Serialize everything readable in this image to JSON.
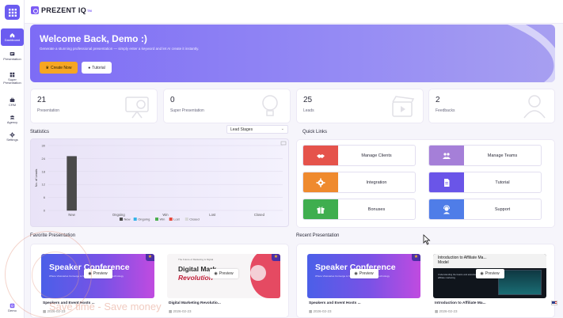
{
  "app": {
    "brand": "PREZENT IQ",
    "brand_tm": "TM"
  },
  "sidebar": {
    "items": [
      {
        "label": "Dashboard",
        "icon": "home-icon",
        "active": true
      },
      {
        "label": "Presentation",
        "icon": "slides-icon"
      },
      {
        "label": "Super Presentation",
        "icon": "grid-icon"
      },
      {
        "label": "CRM",
        "icon": "briefcase-icon"
      },
      {
        "label": "Agency",
        "icon": "people-icon"
      },
      {
        "label": "Settings",
        "icon": "gear-icon"
      }
    ],
    "user_label": "Demo"
  },
  "hero": {
    "title": "Welcome Back, Demo :)",
    "subtitle": "Generate a stunning professional presentation — simply enter a keyword and let AI create it instantly.",
    "create_label": "Create Now",
    "tutorial_label": "Tutorial"
  },
  "stats": [
    {
      "value": "21",
      "label": "Presentation"
    },
    {
      "value": "0",
      "label": "Super Presentation"
    },
    {
      "value": "25",
      "label": "Leads"
    },
    {
      "value": "2",
      "label": "Feedbacks"
    }
  ],
  "statistics": {
    "title": "Statistics",
    "select_value": "Lead Stages"
  },
  "chart_data": {
    "type": "bar",
    "categories": [
      "New",
      "Ongoing",
      "Win",
      "Lost",
      "Closed"
    ],
    "values": [
      25,
      0,
      0,
      0,
      0
    ],
    "ylabel": "No. of Leads",
    "yticks": [
      0,
      6,
      12,
      18,
      24,
      30
    ],
    "ylim": [
      0,
      30
    ],
    "legend": [
      {
        "name": "New",
        "color": "#4a4a4a"
      },
      {
        "name": "Ongoing",
        "color": "#35b3e8"
      },
      {
        "name": "Win",
        "color": "#4caf50"
      },
      {
        "name": "Lost",
        "color": "#e64a3c"
      },
      {
        "name": "Closed",
        "color": "#d8d8d8"
      }
    ],
    "legend_position": "bottom"
  },
  "quick_links": {
    "title": "Quick Links",
    "items": [
      {
        "label": "Manage Clients",
        "color": "#e5534b",
        "icon": "handshake-icon"
      },
      {
        "label": "Manage Teams",
        "color": "#a57fd8",
        "icon": "team-icon"
      },
      {
        "label": "Integration",
        "color": "#ef8a2e",
        "icon": "cog-icon"
      },
      {
        "label": "Tutorial",
        "color": "#6a55e8",
        "icon": "document-icon"
      },
      {
        "label": "Bonuses",
        "color": "#3fae4f",
        "icon": "gift-icon"
      },
      {
        "label": "Support",
        "color": "#4f7de8",
        "icon": "support-agent-icon"
      }
    ]
  },
  "favorite": {
    "title": "Favorite Presentation",
    "cards": [
      {
        "thumb_title": "Speaker Conference",
        "thumb_sub": "Where Visionaries Converge to Shape the Future of Digital Technology",
        "name": "Speakers and Event Hosts ...",
        "date": "2026-02-23",
        "preview": "Preview"
      },
      {
        "thumb_small": "The Future of Marketing is Digital",
        "thumb_l1": "Digital Mark",
        "thumb_l2": "Revolution",
        "name": "Digital Marketing Revolutio...",
        "date": "2026-02-23",
        "preview": "Preview"
      }
    ]
  },
  "recent": {
    "title": "Recent Presentation",
    "cards": [
      {
        "thumb_title": "Speaker Conference",
        "thumb_sub": "Where Visionaries Converge to Shape the Future of Digital Technology",
        "name": "Speakers and Event Hosts ...",
        "date": "2026-02-23",
        "preview": "Preview"
      },
      {
        "thumb_l1": "Introduction to Affiliate Ma...",
        "thumb_l2": "Model",
        "thumb_sub": "Understanding the basics and advantages of affiliate marketing",
        "name": "Introduction to Affiliate Ma...",
        "date": "2026-02-23",
        "preview": "Preview"
      }
    ]
  },
  "watermark": {
    "text": "Save time - Save money"
  }
}
